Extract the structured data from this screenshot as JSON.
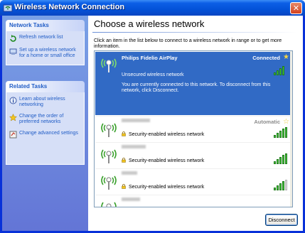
{
  "window": {
    "title": "Wireless Network Connection",
    "close_glyph": "✕"
  },
  "tasks": {
    "network_header": "Network Tasks",
    "network_items": [
      "Refresh network list",
      "Set up a wireless network for a home or small office"
    ],
    "related_header": "Related Tasks",
    "related_items": [
      "Learn about wireless networking",
      "Change the order of preferred networks",
      "Change advanced settings"
    ]
  },
  "main": {
    "title": "Choose a wireless network",
    "instructions": "Click an item in the list below to connect to a wireless network in range or to get more information."
  },
  "networks": {
    "selected": {
      "name": "Philips Fidelio AirPlay",
      "status": "Connected",
      "security": "Unsecured wireless network",
      "description": "You are currently connected to this network. To disconnect from this network, click Disconnect.",
      "signal_bars": 4
    },
    "items": [
      {
        "status": "Automatic",
        "security": "Security-enabled wireless network",
        "signal_bars": 5
      },
      {
        "status": "",
        "security": "Security-enabled wireless network",
        "signal_bars": 5
      },
      {
        "status": "",
        "security": "Security-enabled wireless network",
        "signal_bars": 4
      }
    ]
  },
  "buttons": {
    "disconnect": "Disconnect"
  },
  "icons": [
    "window-wireless-icon",
    "close-icon",
    "refresh-icon",
    "setup-network-icon",
    "info-icon",
    "star-icon",
    "settings-icon",
    "wireless-antenna-icon",
    "lock-icon"
  ],
  "colors": {
    "selection": "#316ac5",
    "titlebar": "#0352d8",
    "taskpane": "#6375d6",
    "signal": "#44c33c"
  }
}
